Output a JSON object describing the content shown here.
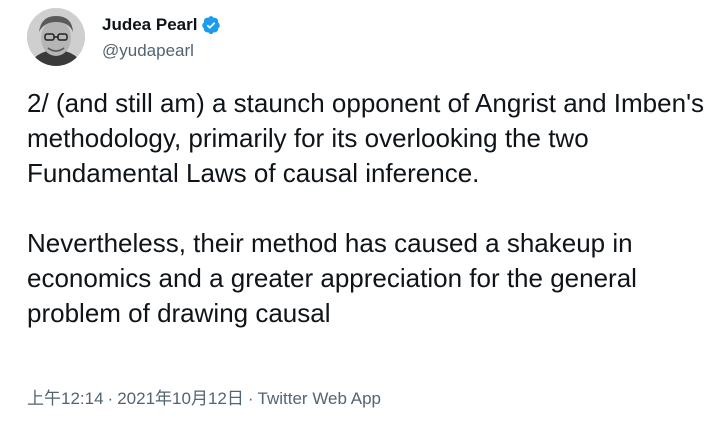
{
  "author": {
    "display_name": "Judea Pearl",
    "handle": "@yudapearl",
    "verified": true,
    "verified_color": "#1d9bf0",
    "avatar_icon": "profile-photo"
  },
  "tweet": {
    "paragraphs": [
      "2/ (and still am) a staunch opponent of Angrist and Imben's methodology, primarily for its overlooking the two Fundamental Laws of causal inference.",
      "Nevertheless, their method has caused a shakeup in economics and a greater appreciation for the general problem of drawing causal"
    ]
  },
  "meta": {
    "time": "上午12:14",
    "separator": "·",
    "date": "2021年10月12日",
    "source": "Twitter Web App"
  }
}
